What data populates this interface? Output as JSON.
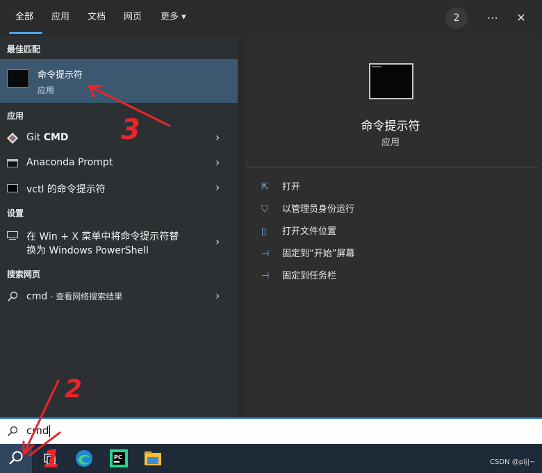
{
  "tabs": [
    {
      "label": "全部",
      "active": true
    },
    {
      "label": "应用"
    },
    {
      "label": "文档"
    },
    {
      "label": "网页"
    },
    {
      "label": "更多 ▾"
    }
  ],
  "top": {
    "badge": "2",
    "more_icon": "ellipsis-icon",
    "close_icon": "close-icon"
  },
  "left": {
    "best_match_header": "最佳匹配",
    "best_match": {
      "title": "命令提示符",
      "subtitle": "应用"
    },
    "apps_header": "应用",
    "apps": [
      {
        "label_a": "Git ",
        "label_b": "CMD",
        "icon": "git-icon"
      },
      {
        "label": "Anaconda Prompt",
        "icon": "terminal-icon"
      },
      {
        "label": "vctl 的命令提示符",
        "icon": "terminal-icon"
      }
    ],
    "settings_header": "设置",
    "settings_item": {
      "line1": "在 Win + X 菜单中将命令提示符替",
      "line2": "换为 Windows PowerShell"
    },
    "web_header": "搜索网页",
    "web_item": {
      "query": "cmd",
      "suffix": " - 查看网络搜索结果"
    }
  },
  "right": {
    "title": "命令提示符",
    "subtitle": "应用",
    "actions": [
      {
        "label": "打开",
        "icon": "open-icon"
      },
      {
        "label": "以管理员身份运行",
        "icon": "shield-icon"
      },
      {
        "label": "打开文件位置",
        "icon": "folder-icon"
      },
      {
        "label": "固定到“开始”屏幕",
        "icon": "pin-icon"
      },
      {
        "label": "固定到任务栏",
        "icon": "pin-icon"
      }
    ]
  },
  "search": {
    "value": "cmd"
  },
  "taskbar": {
    "watermark": "CSDN @plj|~"
  },
  "annotations": {
    "n1": "1",
    "n2": "2",
    "n3": "3"
  }
}
